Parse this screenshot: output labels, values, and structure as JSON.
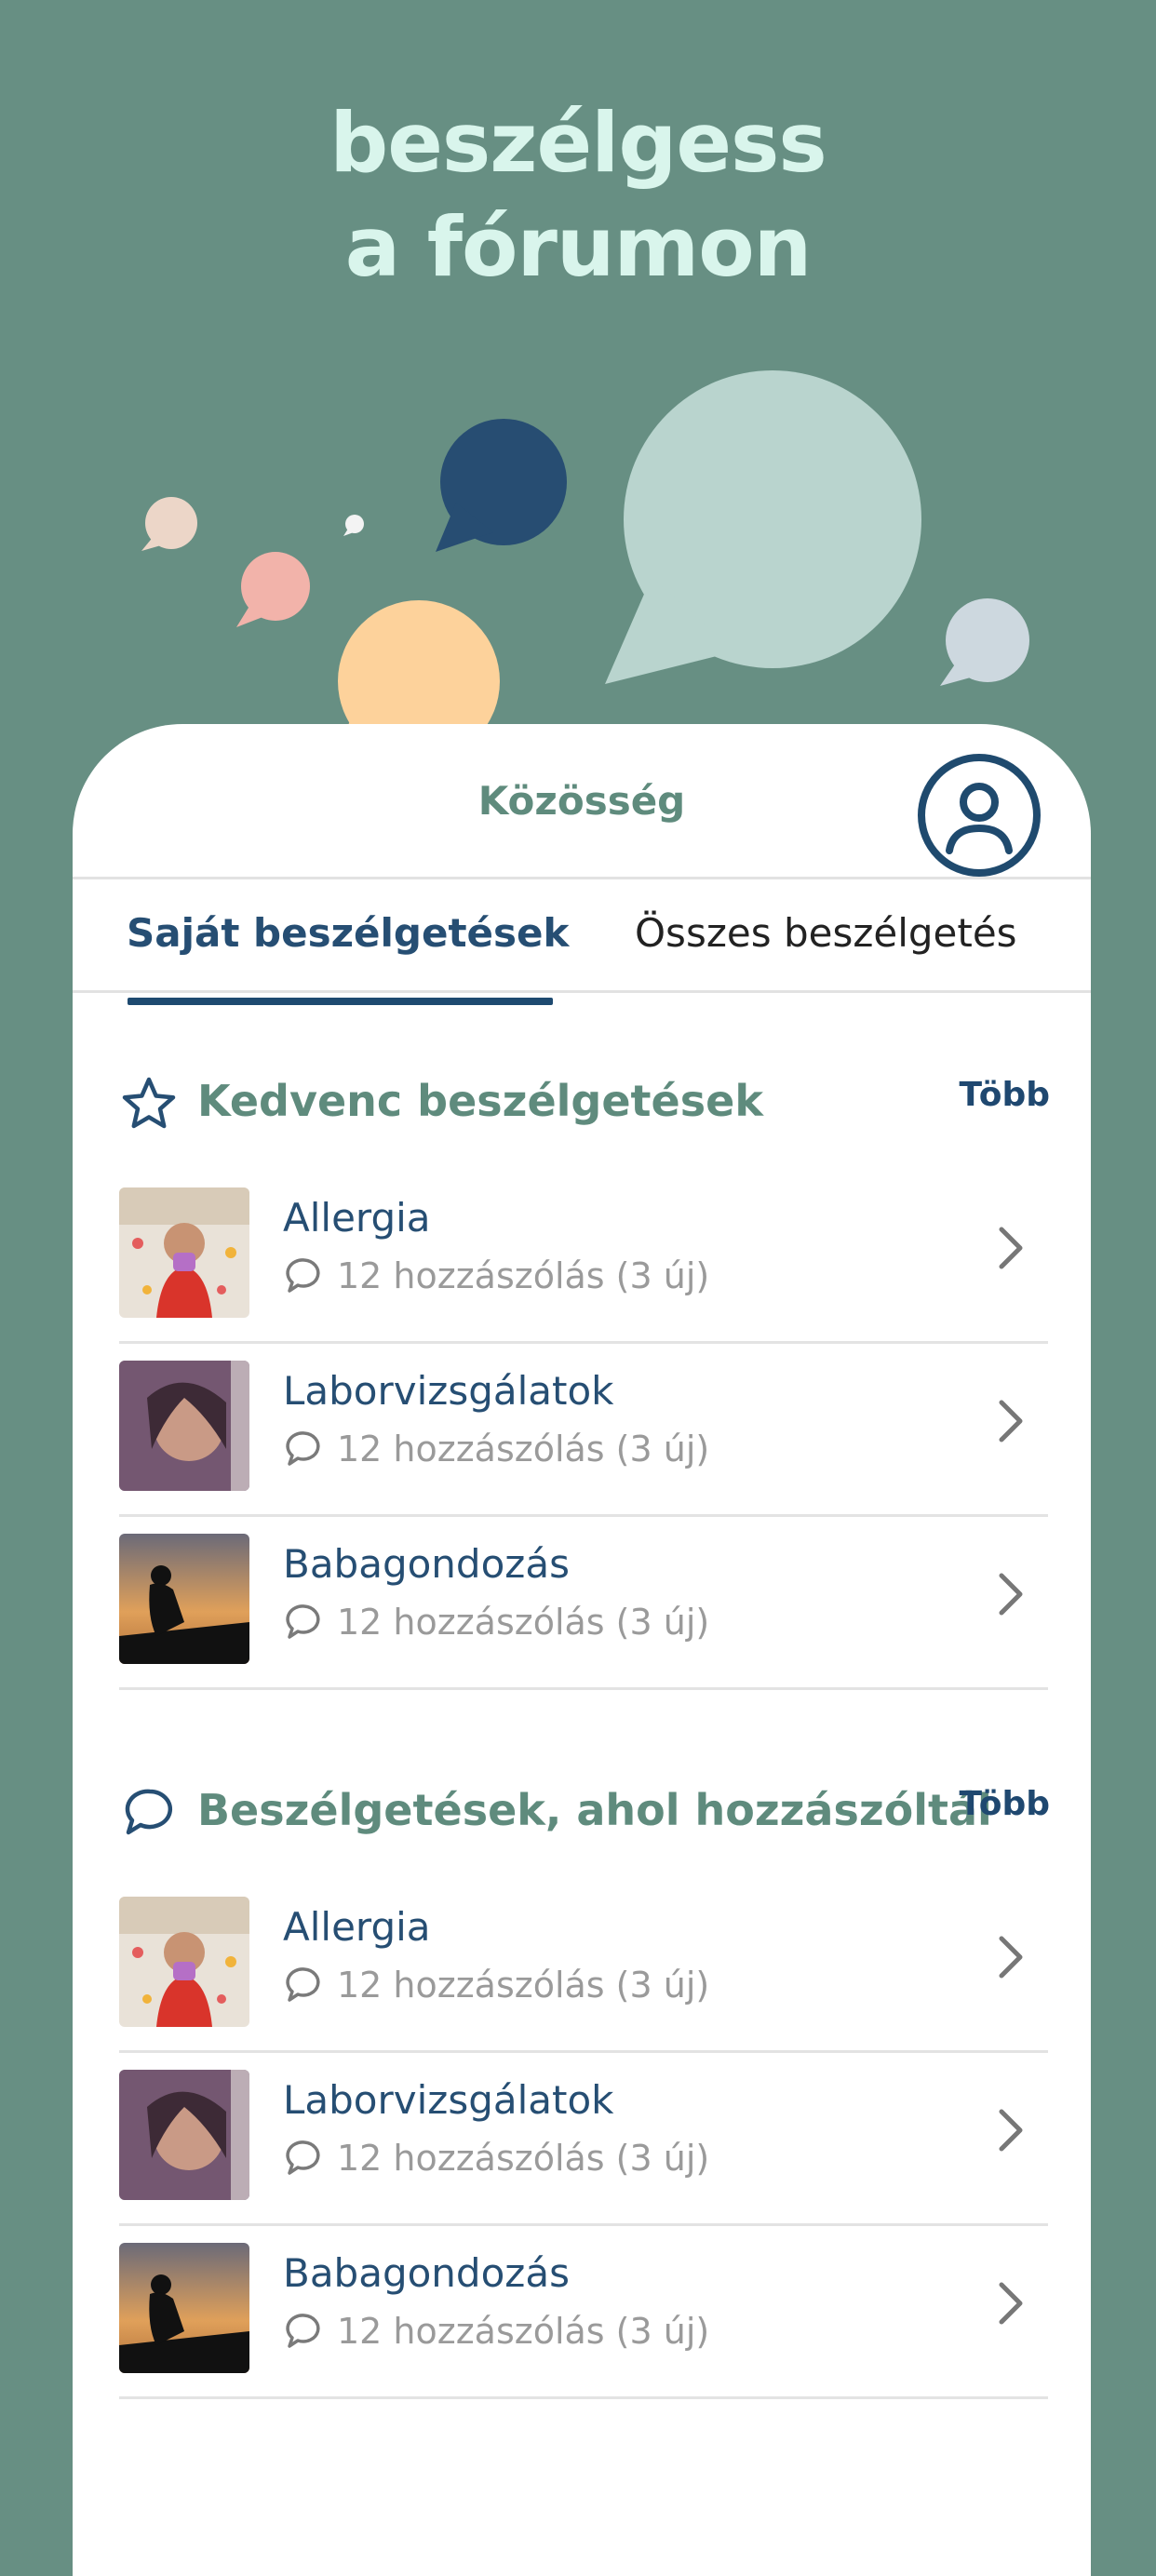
{
  "hero": {
    "title_line1": "beszélgess",
    "title_line2": "a fórumon"
  },
  "app": {
    "title": "Közösség",
    "profile_icon": "user-circle-icon"
  },
  "tabs": [
    {
      "label": "Saját beszélgetések",
      "active": true
    },
    {
      "label": "Összes beszélgetés",
      "active": false
    }
  ],
  "sections": [
    {
      "title": "Kedvenc beszélgetések",
      "icon": "star-icon",
      "more_label": "Több",
      "items": [
        {
          "title": "Allergia",
          "meta": "12 hozzászólás (3 új)"
        },
        {
          "title": "Laborvizsgálatok",
          "meta": "12 hozzászólás (3 új)"
        },
        {
          "title": "Babagondozás",
          "meta": "12 hozzászólás (3 új)"
        }
      ]
    },
    {
      "title": "Beszélgetések, ahol hozzászóltál",
      "icon": "comment-icon",
      "more_label": "Több",
      "items": [
        {
          "title": "Allergia",
          "meta": "12 hozzászólás (3 új)"
        },
        {
          "title": "Laborvizsgálatok",
          "meta": "12 hozzászólás (3 új)"
        },
        {
          "title": "Babagondozás",
          "meta": "12 hozzászólás (3 új)"
        }
      ]
    }
  ],
  "colors": {
    "background": "#678f83",
    "hero_text": "#d9f5ec",
    "accent_green": "#5f8b7d",
    "accent_navy": "#264e73",
    "bubble_navy": "#274d72",
    "bubble_mint": "#b9d4ce",
    "bubble_peach": "#fdd29b",
    "bubble_pink": "#f2b3aa",
    "bubble_beige": "#ecd6c8",
    "bubble_gray": "#cdd8df"
  }
}
